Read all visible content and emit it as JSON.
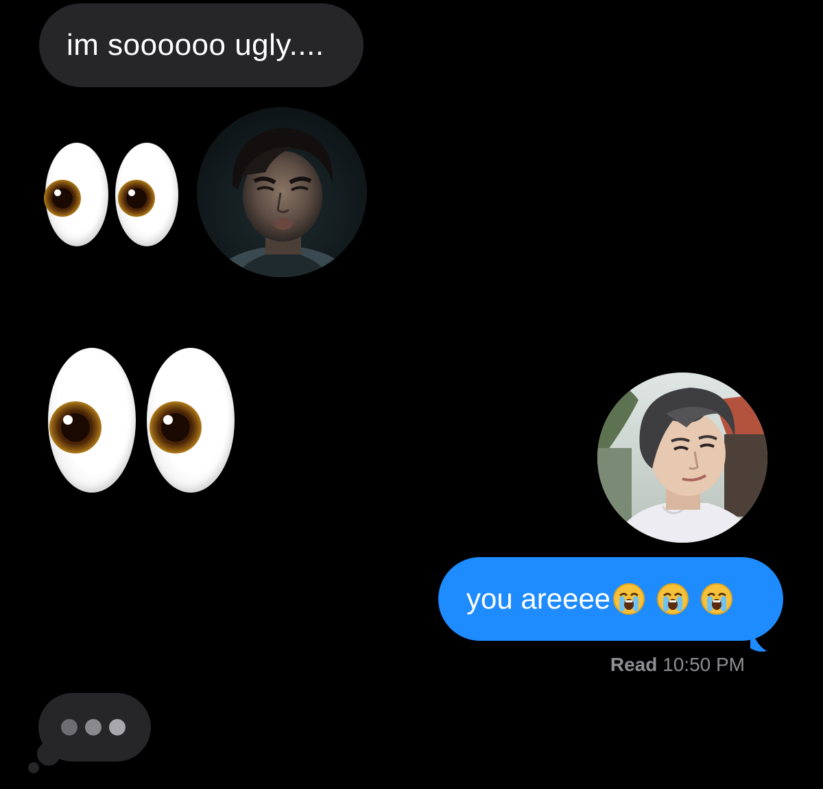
{
  "messages": {
    "incoming_text": "im soooooo ugly....",
    "outgoing_text": "you areeee",
    "outgoing_emoji_count": 3
  },
  "receipt": {
    "status": "Read",
    "time": "10:50 PM"
  },
  "icons": {
    "eyes_small": "eyes-emoji",
    "eyes_large": "eyes-emoji",
    "cry": "loudly-crying-face-emoji"
  },
  "colors": {
    "background": "#000000",
    "incoming_bubble": "#262629",
    "outgoing_bubble": "#1e8bff",
    "receipt_text": "#8e8e93"
  }
}
